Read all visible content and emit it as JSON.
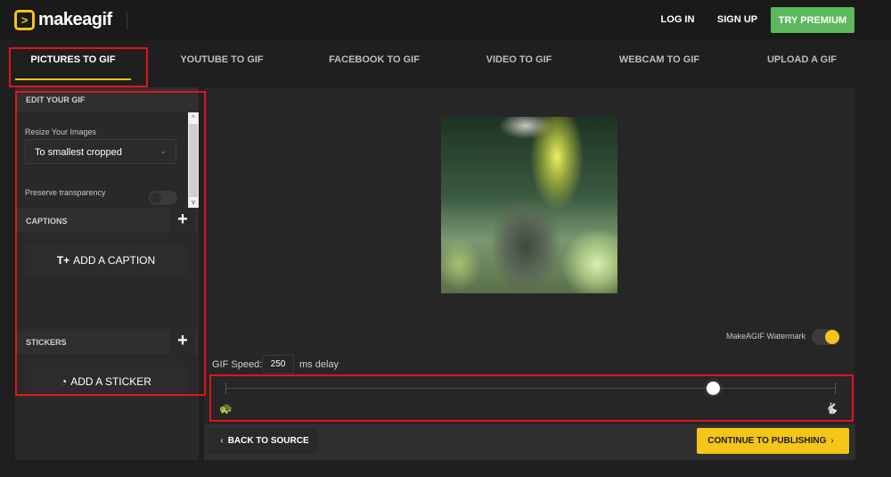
{
  "header": {
    "logo_glyph": ">",
    "logo_text": "makeagif",
    "login": "LOG IN",
    "signup": "SIGN UP",
    "premium": "TRY PREMIUM",
    "premium_color": "#5cb85c"
  },
  "tabs": [
    {
      "label": "PICTURES TO GIF",
      "active": true
    },
    {
      "label": "YOUTUBE TO GIF",
      "active": false
    },
    {
      "label": "FACEBOOK TO GIF",
      "active": false
    },
    {
      "label": "VIDEO TO GIF",
      "active": false
    },
    {
      "label": "WEBCAM TO GIF",
      "active": false
    },
    {
      "label": "UPLOAD A GIF",
      "active": false
    }
  ],
  "sidebar": {
    "edit_header": "EDIT YOUR GIF",
    "resize_label": "Resize Your Images",
    "resize_value": "To smallest cropped",
    "preserve_label": "Preserve transparency",
    "preserve_on": false,
    "captions_header": "CAPTIONS",
    "add_caption": "ADD A CAPTION",
    "stickers_header": "STICKERS",
    "add_sticker": "ADD A STICKER",
    "plus_glyph": "+",
    "scroll_up": "^",
    "scroll_down": "v"
  },
  "main": {
    "watermark_label": "MakeAGIF Watermark",
    "watermark_on": true,
    "speed_label": "GIF Speed:",
    "speed_value": "250",
    "speed_unit": "ms delay",
    "slider_position": 0.8,
    "back_label": "BACK TO SOURCE",
    "continue_label": "CONTINUE TO PUBLISHING",
    "accent_color": "#f5c518"
  },
  "icons": {
    "back_chevron": "‹",
    "continue_chevron": "›",
    "select_chevron": "⌄",
    "caption_icon": "T+",
    "sticker_icon": "◔",
    "slow_icon": "🐢",
    "fast_icon": "🐇"
  }
}
